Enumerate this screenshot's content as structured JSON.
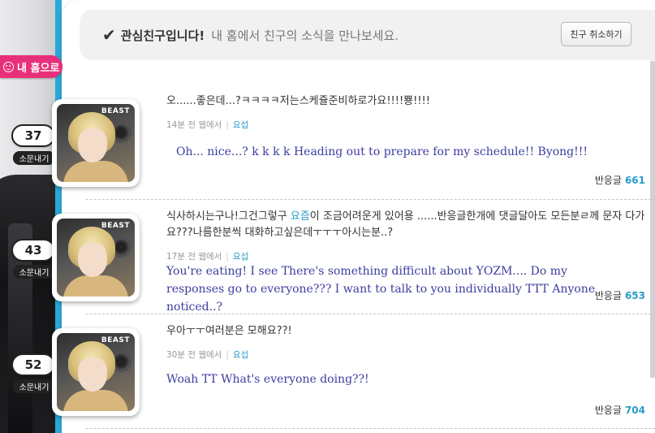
{
  "home_tab": {
    "label": "내 홈으로"
  },
  "banner": {
    "title": "관심친구입니다!",
    "subtitle": "내 홈에서 친구의 소식을 만나보세요.",
    "cancel_button": "친구 취소하기"
  },
  "posts": [
    {
      "count": "37",
      "share_label": "소문내기",
      "text_before": "오......좋은데...?ㅋㅋㅋㅋ저는스케쥴준비하로가요!!!!뿅!!!!",
      "highlight": "",
      "text_after": "",
      "time": "14분 전 웹에서",
      "source": "요섭",
      "translation": "Oh... nice...? k k k k Heading out to prepare for my schedule!! Byong!!!",
      "replies_label": "반응글",
      "replies_count": "661"
    },
    {
      "count": "43",
      "share_label": "소문내기",
      "text_before": "식사하시는구나!그건그렇구 ",
      "highlight": "요즘",
      "text_after": "이 조금어려운게 있어용 ......반응글한개에 댓글달아도 모든분ㄹ께 문자 다가요???나름한분씩 대화하고싶은데ㅜㅜㅜ아시는분..?",
      "time": "17분 전 웹에서",
      "source": "요섭",
      "translation": "You're eating! I see There's something difficult about YOZM.... Do my responses go to everyone??? I want to talk to you individually TTT Anyone noticed..?",
      "replies_label": "반응글",
      "replies_count": "653"
    },
    {
      "count": "52",
      "share_label": "소문내기",
      "text_before": "우아ㅜㅜ여러분은 모해요??!",
      "highlight": "",
      "text_after": "",
      "time": "30분 전 웹에서",
      "source": "요섭",
      "translation": "Woah TT What's everyone doing??!",
      "replies_label": "반응글",
      "replies_count": "704"
    }
  ],
  "avatar_logo": "BEAST",
  "colors": {
    "accent": "#2aa8d8",
    "home_tab": "#e8307a",
    "translation": "#3d3da0"
  }
}
